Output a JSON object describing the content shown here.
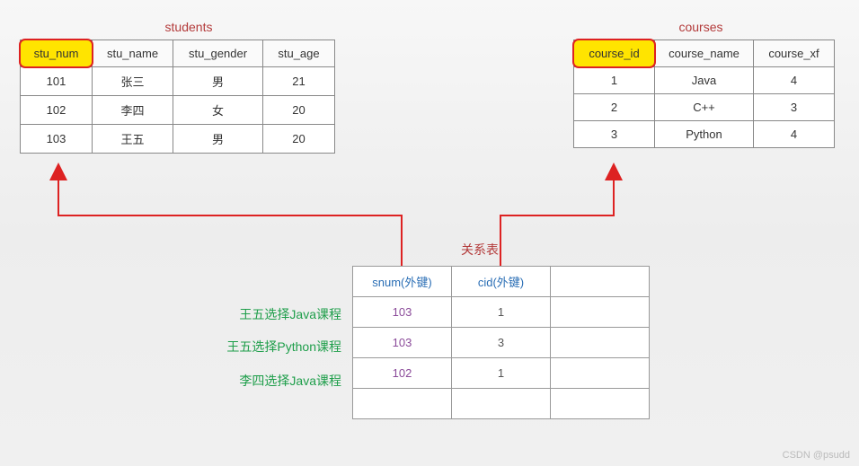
{
  "students": {
    "title": "students",
    "headers": [
      "stu_num",
      "stu_name",
      "stu_gender",
      "stu_age"
    ],
    "highlight_col": 0,
    "rows": [
      [
        "101",
        "张三",
        "男",
        "21"
      ],
      [
        "102",
        "李四",
        "女",
        "20"
      ],
      [
        "103",
        "王五",
        "男",
        "20"
      ]
    ]
  },
  "courses": {
    "title": "courses",
    "headers": [
      "course_id",
      "course_name",
      "course_xf"
    ],
    "highlight_col": 0,
    "rows": [
      [
        "1",
        "Java",
        "4"
      ],
      [
        "2",
        "C++",
        "3"
      ],
      [
        "3",
        "Python",
        "4"
      ]
    ]
  },
  "relation": {
    "title": "关系表",
    "headers": [
      "snum(外键)",
      "cid(外键)",
      ""
    ],
    "rows": [
      {
        "snum": "103",
        "cid": "1",
        "extra": "",
        "note": "王五选择Java课程"
      },
      {
        "snum": "103",
        "cid": "3",
        "extra": "",
        "note": "王五选择Python课程"
      },
      {
        "snum": "102",
        "cid": "1",
        "extra": "",
        "note": "李四选择Java课程"
      },
      {
        "snum": "",
        "cid": "",
        "extra": "",
        "note": ""
      }
    ]
  },
  "watermark": "CSDN @psudd",
  "chart_data": {
    "type": "table",
    "title": "Many-to-many relationship via junction table",
    "tables": [
      {
        "name": "students",
        "primary_key": "stu_num",
        "columns": [
          "stu_num",
          "stu_name",
          "stu_gender",
          "stu_age"
        ],
        "rows": [
          [
            101,
            "张三",
            "男",
            21
          ],
          [
            102,
            "李四",
            "女",
            20
          ],
          [
            103,
            "王五",
            "男",
            20
          ]
        ]
      },
      {
        "name": "courses",
        "primary_key": "course_id",
        "columns": [
          "course_id",
          "course_name",
          "course_xf"
        ],
        "rows": [
          [
            1,
            "Java",
            4
          ],
          [
            2,
            "C++",
            3
          ],
          [
            3,
            "Python",
            4
          ]
        ]
      },
      {
        "name": "关系表",
        "columns": [
          "snum(外键)",
          "cid(外键)"
        ],
        "foreign_keys": {
          "snum": "students.stu_num",
          "cid": "courses.course_id"
        },
        "rows": [
          [
            103,
            1
          ],
          [
            103,
            3
          ],
          [
            102,
            1
          ]
        ]
      }
    ],
    "annotations": [
      "王五选择Java课程",
      "王五选择Python课程",
      "李四选择Java课程"
    ]
  }
}
